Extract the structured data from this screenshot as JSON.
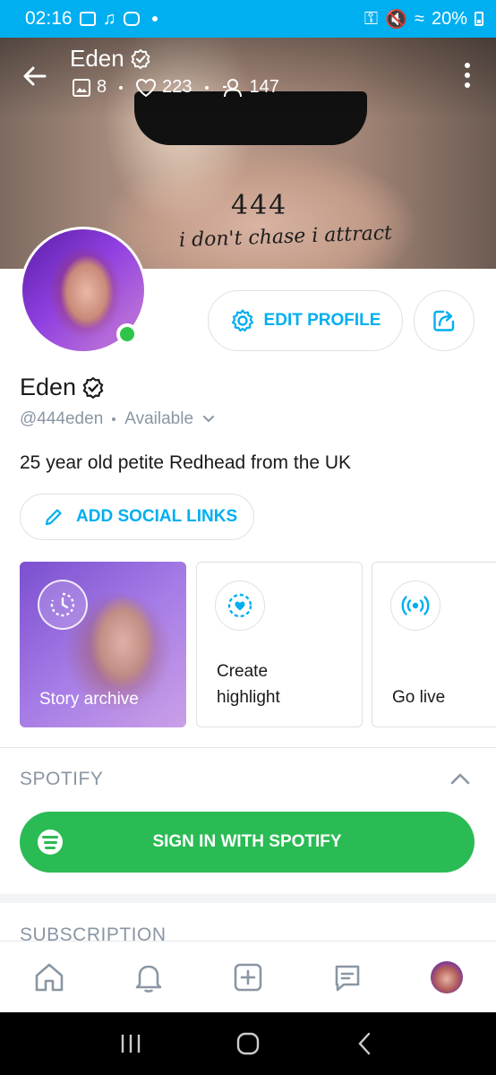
{
  "status_bar": {
    "time": "02:16",
    "battery": "20%",
    "accent": "#00aff0"
  },
  "cover": {
    "tattoo_number": "444",
    "tattoo_text": "i don't chase i attract"
  },
  "header": {
    "name": "Eden",
    "verified_icon": "verified-badge-icon",
    "stats": {
      "media": "8",
      "likes": "223",
      "fans": "147"
    }
  },
  "profile": {
    "online_color": "#2ec44a",
    "edit_label": "EDIT PROFILE",
    "name": "Eden",
    "handle": "@444eden",
    "availability": "Available",
    "bio": "25 year old petite Redhead from the UK",
    "social_label": "ADD SOCIAL LINKS"
  },
  "cards": {
    "story": "Story archive",
    "highlight_line1": "Create",
    "highlight_line2": "highlight",
    "live": "Go live"
  },
  "spotify": {
    "title": "SPOTIFY",
    "button": "SIGN IN WITH SPOTIFY",
    "color": "#2bbb55"
  },
  "subscription": {
    "title": "SUBSCRIPTION"
  },
  "nav": {
    "items": [
      "home-icon",
      "bell-icon",
      "add-post-icon",
      "messages-icon",
      "profile-avatar"
    ]
  }
}
